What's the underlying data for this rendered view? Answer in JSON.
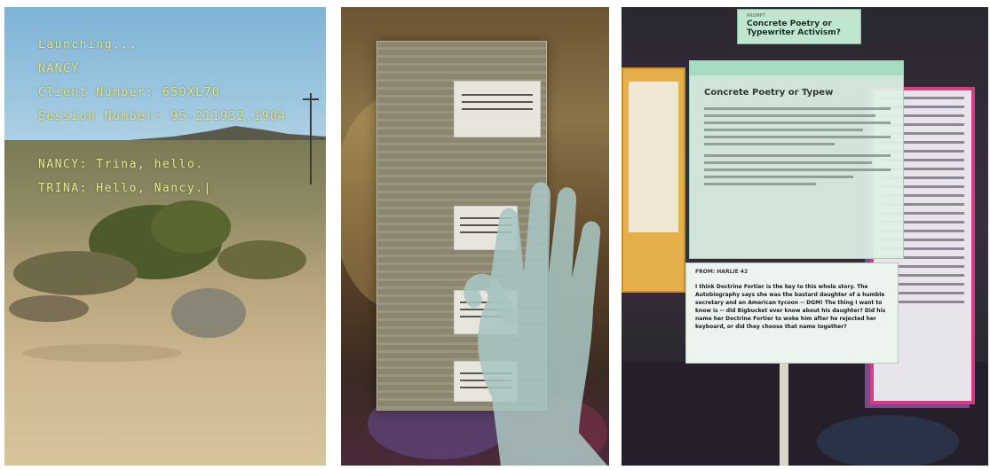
{
  "panel1": {
    "lines": [
      "Launching...",
      "NANCY",
      "Client Number: 650XL70",
      "Session Number: 95-211932.1904"
    ],
    "dialog": [
      {
        "speaker": "NANCY",
        "text": ": Trina, hello."
      },
      {
        "speaker": "TRINA",
        "text": ": Hello, Nancy.|"
      }
    ]
  },
  "panel3": {
    "title_prefix": "PROMPT",
    "title": "Concrete Poetry or Typewriter Activism?",
    "main_heading": "Concrete Poetry or Typew",
    "reply_from": "FROM: HARLIE 42",
    "reply_text": "I think Doctrine Fortier is the key to this whole story. The Autobiography says she was the bastard daughter of a humble secretary and an American tycoon -- DGM! The thing I want to know is -- did Bigbucket ever know about his daughter? Did his name her Doctrine Fortier to woke him after he rejected her keyboard, or did they choose that name together?"
  }
}
